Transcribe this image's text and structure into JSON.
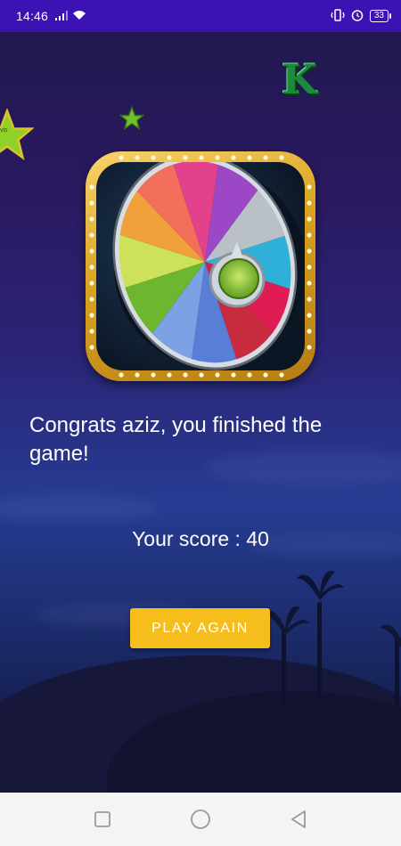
{
  "status_bar": {
    "time": "14:46",
    "battery_level": "33",
    "icons": [
      "signal-icon",
      "wifi-icon",
      "vibrate-icon",
      "alarm-icon",
      "battery-icon"
    ]
  },
  "game": {
    "congrats_message": "Congrats aziz, you finished the game!",
    "score_text": "Your score : 40",
    "play_again_label": "PLAY AGAIN",
    "accent_color": "#f5be1c"
  },
  "decorations": {
    "letter_tile": "K",
    "star_tile_text": "vis"
  },
  "nav_bar": {
    "buttons": [
      "recent-apps",
      "home",
      "back"
    ]
  }
}
